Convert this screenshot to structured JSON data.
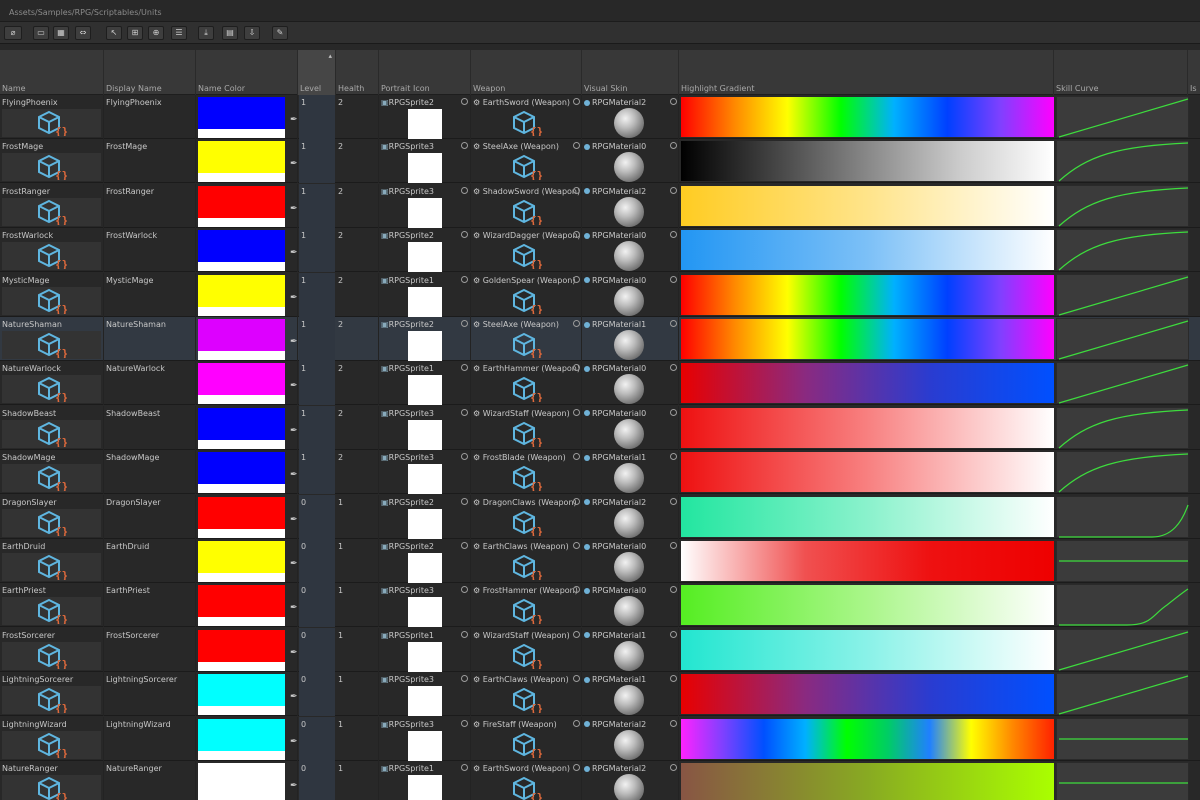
{
  "path": "Assets/Samples/RPG/Scriptables/Units",
  "toolbar": {
    "buttons": [
      {
        "name": "toggle-button",
        "glyph": "⌀"
      },
      {
        "name": "layout-single-button",
        "glyph": "▭"
      },
      {
        "name": "layout-grid-button",
        "glyph": "▦"
      },
      {
        "name": "layout-fit-button",
        "glyph": "⇔"
      },
      {
        "name": "select-button",
        "glyph": "↖"
      },
      {
        "name": "multi-select-button",
        "glyph": "⊞"
      },
      {
        "name": "add-column-button",
        "glyph": "⊕"
      },
      {
        "name": "list-view-button",
        "glyph": "☰"
      },
      {
        "name": "import-button",
        "glyph": "⤓"
      },
      {
        "name": "open-folder-button",
        "glyph": "▤"
      },
      {
        "name": "save-button",
        "glyph": "⇩"
      },
      {
        "name": "edit-button",
        "glyph": "✎"
      }
    ]
  },
  "columns": {
    "name": "Name",
    "display_name": "Display Name",
    "name_color": "Name Color",
    "level": "Level",
    "health": "Health",
    "portrait_icon": "Portrait Icon",
    "weapon": "Weapon",
    "visual_skin": "Visual Skin",
    "highlight_gradient": "Highlight Gradient",
    "skill_curve": "Skill Curve",
    "is": "Is"
  },
  "rows": [
    {
      "name": "FlyingPhoenix",
      "display": "FlyingPhoenix",
      "color": "#0000ff",
      "level": "1",
      "health": "2",
      "sprite": "RPGSprite2",
      "weapon": "EarthSword (Weapon)",
      "skin": "RPGMaterial2",
      "gradient": "linear-gradient(90deg,#ff0000,#ff8800,#ffff00,#00ff00,#00b0ff,#0040ff,#8040ff,#ff00ff)",
      "curve": "linear"
    },
    {
      "name": "FrostMage",
      "display": "FrostMage",
      "color": "#ffff00",
      "level": "1",
      "health": "2",
      "sprite": "RPGSprite3",
      "weapon": "SteelAxe (Weapon)",
      "skin": "RPGMaterial0",
      "gradient": "linear-gradient(90deg,#000000,#444444,#888888,#cccccc,#ffffff)",
      "curve": "ease-out"
    },
    {
      "name": "FrostRanger",
      "display": "FrostRanger",
      "color": "#ff0000",
      "level": "1",
      "health": "2",
      "sprite": "RPGSprite3",
      "weapon": "ShadowSword (Weapon)",
      "skin": "RPGMaterial2",
      "gradient": "linear-gradient(90deg,#ffcc22,#ffe48a,#ffffff)",
      "curve": "ease-out"
    },
    {
      "name": "FrostWarlock",
      "display": "FrostWarlock",
      "color": "#0000ff",
      "level": "1",
      "health": "2",
      "sprite": "RPGSprite2",
      "weapon": "WizardDagger (Weapon)",
      "skin": "RPGMaterial0",
      "gradient": "linear-gradient(90deg,#2296f3,#7cc0f7,#ffffff)",
      "curve": "ease-out"
    },
    {
      "name": "MysticMage",
      "display": "MysticMage",
      "color": "#ffff00",
      "level": "1",
      "health": "2",
      "sprite": "RPGSprite1",
      "weapon": "GoldenSpear (Weapon)",
      "skin": "RPGMaterial0",
      "gradient": "linear-gradient(90deg,#ff0000,#ff8800,#ffff00,#00ff00,#00b0ff,#0040ff,#8040ff,#ff00ff)",
      "curve": "linear"
    },
    {
      "name": "NatureShaman",
      "display": "NatureShaman",
      "color": "#dd00ff",
      "level": "1",
      "health": "2",
      "sprite": "RPGSprite2",
      "weapon": "SteelAxe (Weapon)",
      "skin": "RPGMaterial1",
      "gradient": "linear-gradient(90deg,#ff0000,#ff8800,#ffff00,#00ff00,#00b0ff,#0040ff,#8040ff,#ff00ff)",
      "curve": "linear",
      "selected": true
    },
    {
      "name": "NatureWarlock",
      "display": "NatureWarlock",
      "color": "#ff00ff",
      "level": "1",
      "health": "2",
      "sprite": "RPGSprite1",
      "weapon": "EarthHammer (Weapon)",
      "skin": "RPGMaterial0",
      "gradient": "linear-gradient(90deg,#e80000,#8a2a80,#2a3cd0,#0050ff)",
      "curve": "linear"
    },
    {
      "name": "ShadowBeast",
      "display": "ShadowBeast",
      "color": "#0000ff",
      "level": "1",
      "health": "2",
      "sprite": "RPGSprite3",
      "weapon": "WizardStaff (Weapon)",
      "skin": "RPGMaterial0",
      "gradient": "linear-gradient(90deg,#ee1111,#f88080,#ffffff)",
      "curve": "ease-out"
    },
    {
      "name": "ShadowMage",
      "display": "ShadowMage",
      "color": "#0000ff",
      "level": "1",
      "health": "2",
      "sprite": "RPGSprite3",
      "weapon": "FrostBlade (Weapon)",
      "skin": "RPGMaterial1",
      "gradient": "linear-gradient(90deg,#ee1111,#f88080,#ffffff)",
      "curve": "ease-out"
    },
    {
      "name": "DragonSlayer",
      "display": "DragonSlayer",
      "color": "#ff0000",
      "level": "0",
      "health": "1",
      "sprite": "RPGSprite2",
      "weapon": "DragonClaws (Weapon)",
      "skin": "RPGMaterial2",
      "gradient": "linear-gradient(90deg,#22e6a0,#8af2cc,#ffffff)",
      "curve": "ease-in"
    },
    {
      "name": "EarthDruid",
      "display": "EarthDruid",
      "color": "#ffff00",
      "level": "0",
      "health": "1",
      "sprite": "RPGSprite2",
      "weapon": "EarthClaws (Weapon)",
      "skin": "RPGMaterial0",
      "gradient": "linear-gradient(90deg,#ffffff,#f05050,#ee1111,#ee0000)",
      "curve": "flat"
    },
    {
      "name": "EarthPriest",
      "display": "EarthPriest",
      "color": "#ff0000",
      "level": "0",
      "health": "1",
      "sprite": "RPGSprite3",
      "weapon": "FrostHammer (Weapon)",
      "skin": "RPGMaterial0",
      "gradient": "linear-gradient(90deg,#55ee22,#aaf68a,#ffffff)",
      "curve": "s-curve"
    },
    {
      "name": "FrostSorcerer",
      "display": "FrostSorcerer",
      "color": "#ff0000",
      "level": "0",
      "health": "1",
      "sprite": "RPGSprite1",
      "weapon": "WizardStaff (Weapon)",
      "skin": "RPGMaterial1",
      "gradient": "linear-gradient(90deg,#22e6d0,#8af2e8,#ffffff)",
      "curve": "linear"
    },
    {
      "name": "LightningSorcerer",
      "display": "LightningSorcerer",
      "color": "#00ffff",
      "level": "0",
      "health": "1",
      "sprite": "RPGSprite3",
      "weapon": "EarthClaws (Weapon)",
      "skin": "RPGMaterial1",
      "gradient": "linear-gradient(90deg,#e80000,#8a2a80,#2a3cd0,#0050ff)",
      "curve": "linear"
    },
    {
      "name": "LightningWizard",
      "display": "LightningWizard",
      "color": "#00ffff",
      "level": "0",
      "health": "1",
      "sprite": "RPGSprite3",
      "weapon": "FireStaff (Weapon)",
      "skin": "RPGMaterial2",
      "gradient": "linear-gradient(90deg,#ff22ff,#8040ff,#0050ff,#00b0ff,#00ff00,#00cc66,#2080ff,#ffff00,#ff8800,#ff2200)",
      "curve": "flat"
    },
    {
      "name": "NatureRanger",
      "display": "NatureRanger",
      "color": "#ffffff",
      "level": "0",
      "health": "1",
      "sprite": "RPGSprite1",
      "weapon": "EarthSword (Weapon)",
      "skin": "RPGMaterial2",
      "gradient": "linear-gradient(90deg,#885544,#88aa22,#aaff00)",
      "curve": "flat"
    }
  ]
}
